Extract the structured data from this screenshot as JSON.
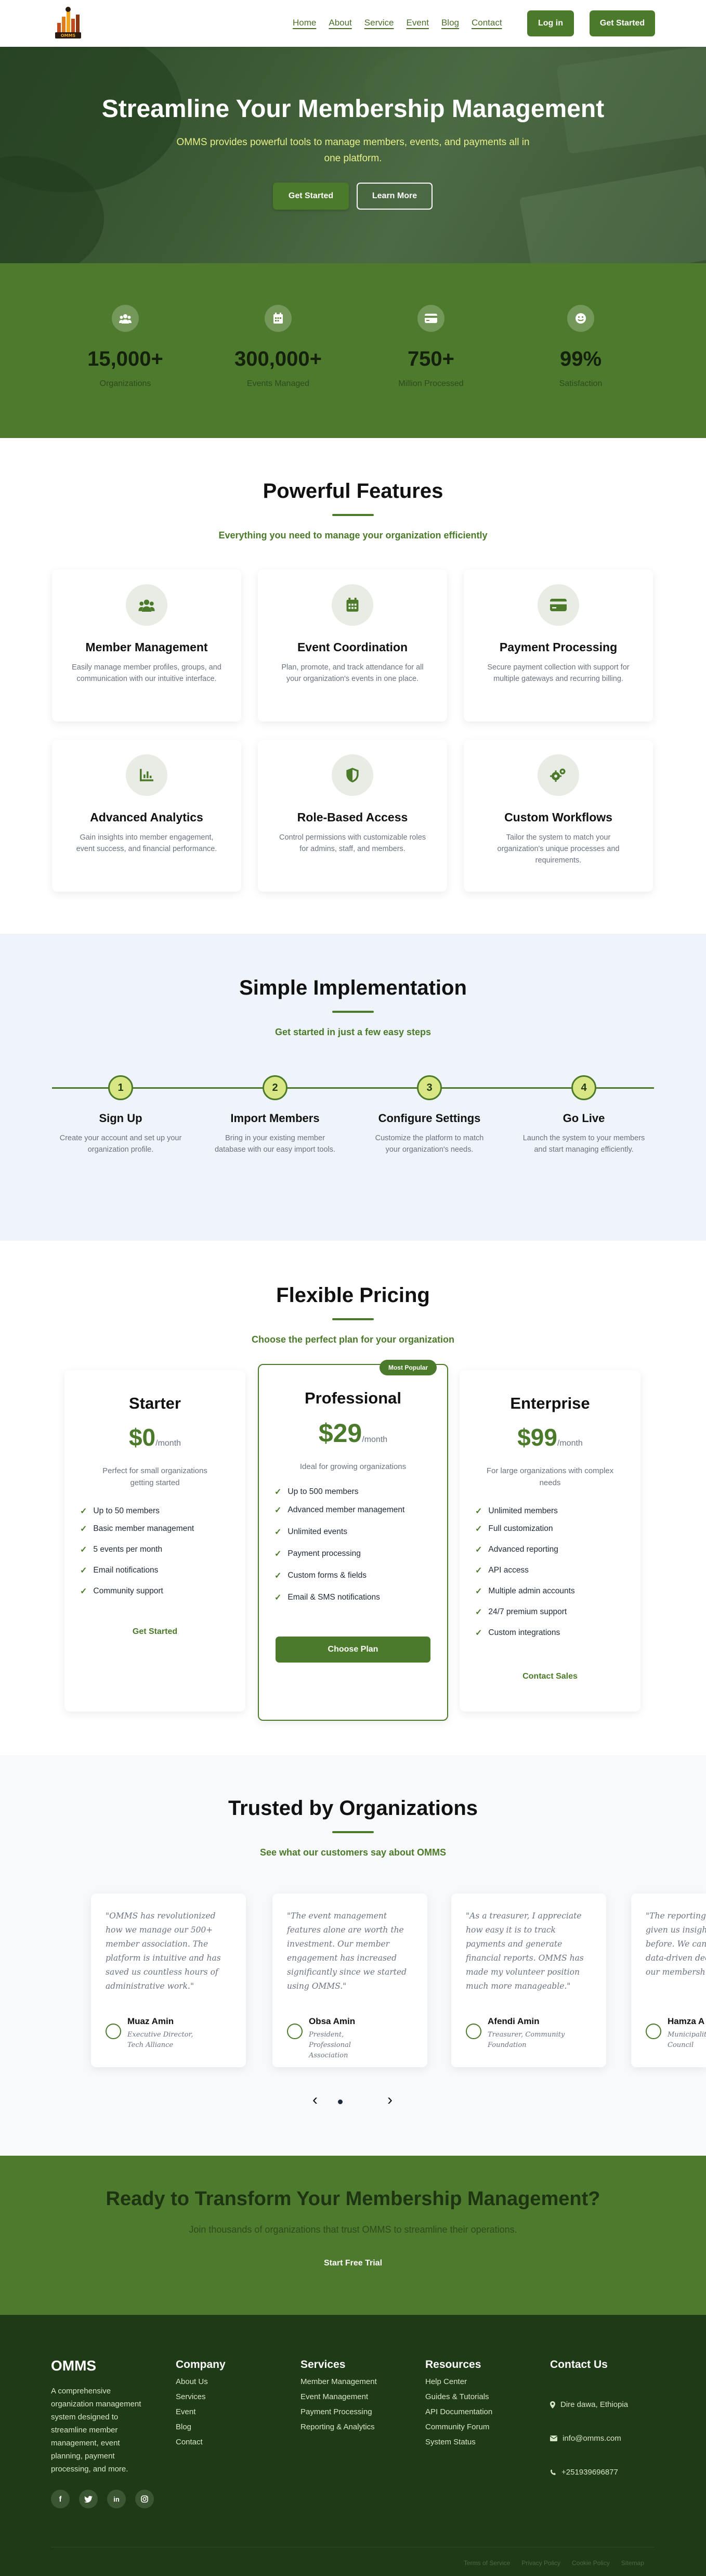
{
  "nav": {
    "logo_text": "OMMS",
    "links": [
      "Home",
      "About",
      "Service",
      "Event",
      "Blog",
      "Contact"
    ],
    "login": "Log in",
    "cta": "Get Started"
  },
  "hero": {
    "title": "Streamline Your Membership Management",
    "subtitle": "OMMS provides powerful tools to manage members, events, and payments all in one platform.",
    "primary": "Get Started",
    "secondary": "Learn More"
  },
  "stats": [
    {
      "icon": "users-icon",
      "value": "15,000+",
      "label": "Organizations"
    },
    {
      "icon": "calendar-icon",
      "value": "300,000+",
      "label": "Events Managed"
    },
    {
      "icon": "credit-card-icon",
      "value": "750+",
      "label": "Million Processed"
    },
    {
      "icon": "smile-icon",
      "value": "99%",
      "label": "Satisfaction"
    }
  ],
  "features": {
    "title": "Powerful Features",
    "subtitle": "Everything you need to manage your organization efficiently",
    "items": [
      {
        "icon": "users-icon",
        "title": "Member Management",
        "desc": "Easily manage member profiles, groups, and communication with our intuitive interface."
      },
      {
        "icon": "calendar-icon",
        "title": "Event Coordination",
        "desc": "Plan, promote, and track attendance for all your organization's events in one place."
      },
      {
        "icon": "credit-card-icon",
        "title": "Payment Processing",
        "desc": "Secure payment collection with support for multiple gateways and recurring billing."
      },
      {
        "icon": "chart-icon",
        "title": "Advanced Analytics",
        "desc": "Gain insights into member engagement, event success, and financial performance."
      },
      {
        "icon": "shield-icon",
        "title": "Role-Based Access",
        "desc": "Control permissions with customizable roles for admins, staff, and members."
      },
      {
        "icon": "cogs-icon",
        "title": "Custom Workflows",
        "desc": "Tailor the system to match your organization's unique processes and requirements."
      }
    ]
  },
  "steps": {
    "title": "Simple Implementation",
    "subtitle": "Get started in just a few easy steps",
    "items": [
      {
        "num": "1",
        "title": "Sign Up",
        "desc": "Create your account and set up your organization profile."
      },
      {
        "num": "2",
        "title": "Import Members",
        "desc": "Bring in your existing member database with our easy import tools."
      },
      {
        "num": "3",
        "title": "Configure Settings",
        "desc": "Customize the platform to match your organization's needs."
      },
      {
        "num": "4",
        "title": "Go Live",
        "desc": "Launch the system to your members and start managing efficiently."
      }
    ]
  },
  "pricing": {
    "title": "Flexible Pricing",
    "subtitle": "Choose the perfect plan for your organization",
    "badge": "Most Popular",
    "plans": [
      {
        "name": "Starter",
        "price": "$0",
        "per": "/month",
        "desc": "Perfect for small organizations getting started",
        "features": [
          "Up to 50 members",
          "Basic member management",
          "5 events per month",
          "Email notifications",
          "Community support"
        ],
        "cta": "Get Started"
      },
      {
        "name": "Professional",
        "price": "$29",
        "per": "/month",
        "desc": "Ideal for growing organizations",
        "features": [
          "Up to 500 members",
          "Advanced member management",
          "Unlimited events",
          "Payment processing",
          "Custom forms & fields",
          "Email & SMS notifications"
        ],
        "cta": "Choose Plan"
      },
      {
        "name": "Enterprise",
        "price": "$99",
        "per": "/month",
        "desc": "For large organizations with complex needs",
        "features": [
          "Unlimited members",
          "Full customization",
          "Advanced reporting",
          "API access",
          "Multiple admin accounts",
          "24/7 premium support",
          "Custom integrations"
        ],
        "cta": "Contact Sales"
      }
    ]
  },
  "testimonials": {
    "title": "Trusted by Organizations",
    "subtitle": "See what our customers say about OMMS",
    "items": [
      {
        "quote": "\"OMMS has revolutionized how we manage our 500+ member association. The platform is intuitive and has saved us countless hours of administrative work.\"",
        "name": "Muaz Amin",
        "role": "Executive Director, Tech Alliance"
      },
      {
        "quote": "\"The event management features alone are worth the investment. Our member engagement has increased significantly since we started using OMMS.\"",
        "name": "Obsa Amin",
        "role": "President, Professional Association"
      },
      {
        "quote": "\"As a treasurer, I appreciate how easy it is to track payments and generate financial reports. OMMS has made my volunteer position much more manageable.\"",
        "name": "Afendi Amin",
        "role": "Treasurer, Community Foundation"
      },
      {
        "quote": "\"The reporting given us insight before. We can data-driven dec our membersh",
        "name": "Hamza A",
        "role": "Municipality Council"
      }
    ],
    "prev": "‹",
    "next": "›"
  },
  "cta_section": {
    "title": "Ready to Transform Your Membership Management?",
    "subtitle": "Join thousands of organizations that trust OMMS to streamline their operations.",
    "button": "Start Free Trial"
  },
  "footer": {
    "brand": "OMMS",
    "about": "A comprehensive organization management system designed to streamline member management, event planning, payment processing, and more.",
    "socials": [
      "facebook-icon",
      "twitter-icon",
      "linkedin-icon",
      "instagram-icon"
    ],
    "company": {
      "title": "Company",
      "links": [
        "About Us",
        "Services",
        "Event",
        "Blog",
        "Contact"
      ]
    },
    "services": {
      "title": "Services",
      "links": [
        "Member Management",
        "Event Management",
        "Payment Processing",
        "Reporting & Analytics"
      ]
    },
    "resources": {
      "title": "Resources",
      "links": [
        "Help Center",
        "Guides & Tutorials",
        "API Documentation",
        "Community Forum",
        "System Status"
      ]
    },
    "contact": {
      "title": "Contact Us",
      "address": "Dire dawa, Ethiopia",
      "email": "info@omms.com",
      "phone": "+251939696877"
    },
    "legal": [
      "Terms of Service",
      "Privacy Policy",
      "Cookie Policy",
      "Sitemap"
    ]
  },
  "colors": {
    "primary": "#4a7a2a",
    "dark": "#1e3a17",
    "accent": "#d8e684"
  }
}
